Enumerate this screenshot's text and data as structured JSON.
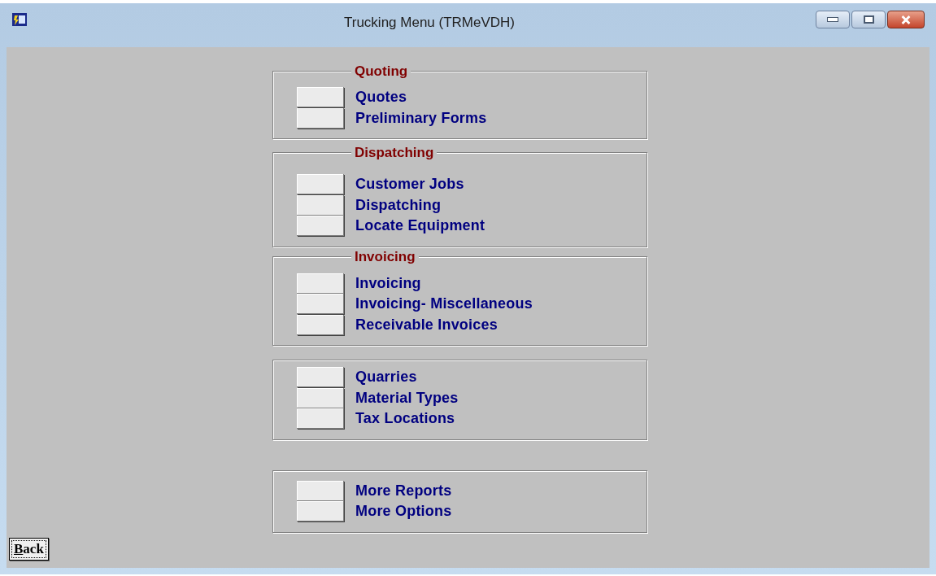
{
  "window": {
    "title": "Trucking Menu (TRMeVDH)"
  },
  "groups": [
    {
      "legend": "Quoting",
      "items": [
        {
          "label": "Quotes"
        },
        {
          "label": "Preliminary Forms"
        }
      ]
    },
    {
      "legend": "Dispatching",
      "items": [
        {
          "label": "Customer Jobs"
        },
        {
          "label": "Dispatching"
        },
        {
          "label": "Locate Equipment"
        }
      ]
    },
    {
      "legend": "Invoicing",
      "items": [
        {
          "label": "Invoicing"
        },
        {
          "label": "Invoicing- Miscellaneous"
        },
        {
          "label": "Receivable Invoices"
        }
      ]
    },
    {
      "items": [
        {
          "label": "Quarries"
        },
        {
          "label": "Material Types"
        },
        {
          "label": "Tax Locations"
        }
      ]
    },
    {
      "items": [
        {
          "label": "More Reports"
        },
        {
          "label": "More Options"
        }
      ]
    }
  ],
  "back_button": {
    "label": "Back"
  }
}
